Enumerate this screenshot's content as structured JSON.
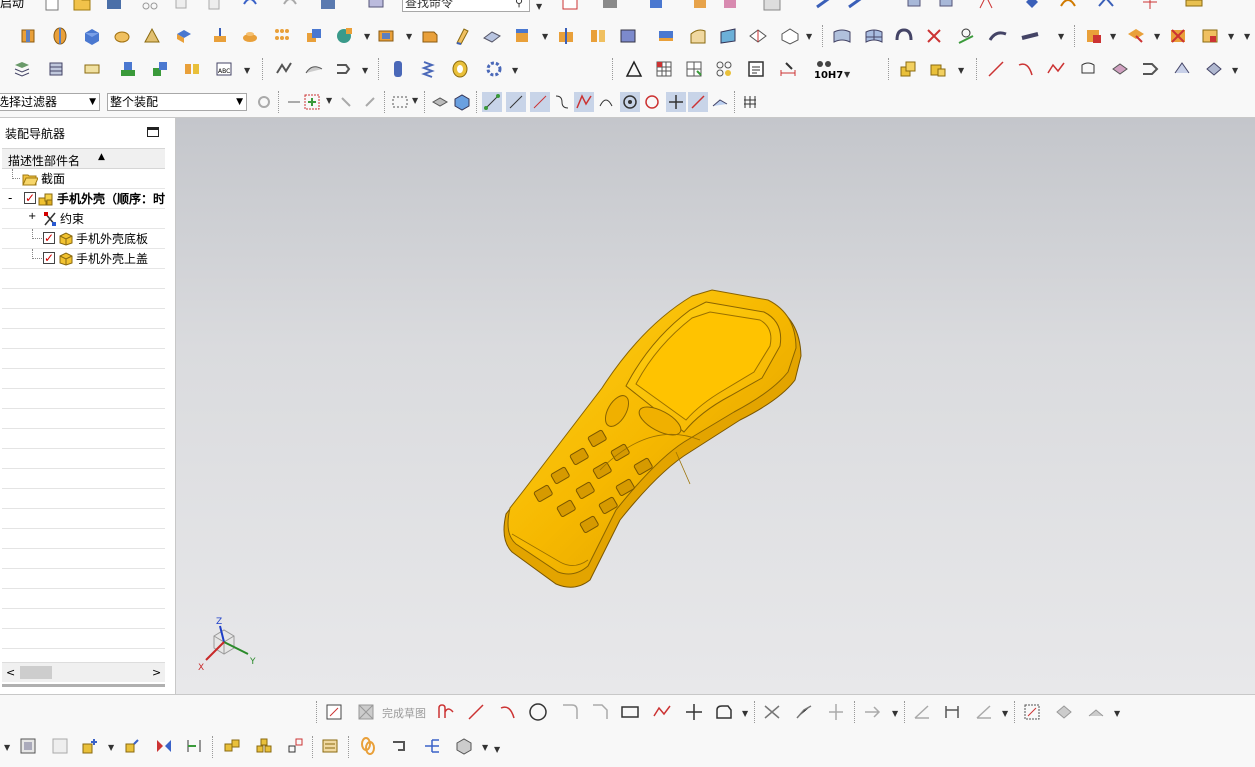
{
  "toolbar": {
    "start_label": "启动",
    "command_search_placeholder": "查找命令",
    "selection_filter": "选择过滤器",
    "assembly_scope": "整个装配",
    "tolerance_label": "10H7"
  },
  "navigator": {
    "title": "装配导航器",
    "column_header": "描述性部件名",
    "items": [
      {
        "label": "截面"
      },
      {
        "label": "手机外壳（顺序：时"
      },
      {
        "label": "约束"
      },
      {
        "label": "手机外壳底板"
      },
      {
        "label": "手机外壳上盖"
      }
    ]
  },
  "sketch_toolbar": {
    "finish_sketch_label": "完成草图"
  },
  "triad": {
    "z": "Z",
    "y": "Y",
    "x": "X"
  },
  "colors": {
    "model": "#f6b800",
    "model_shadow": "#d99800",
    "viewport_top": "#c4c6cb",
    "viewport_bottom": "#e8e8ea",
    "checkbox_red": "#d40000"
  }
}
